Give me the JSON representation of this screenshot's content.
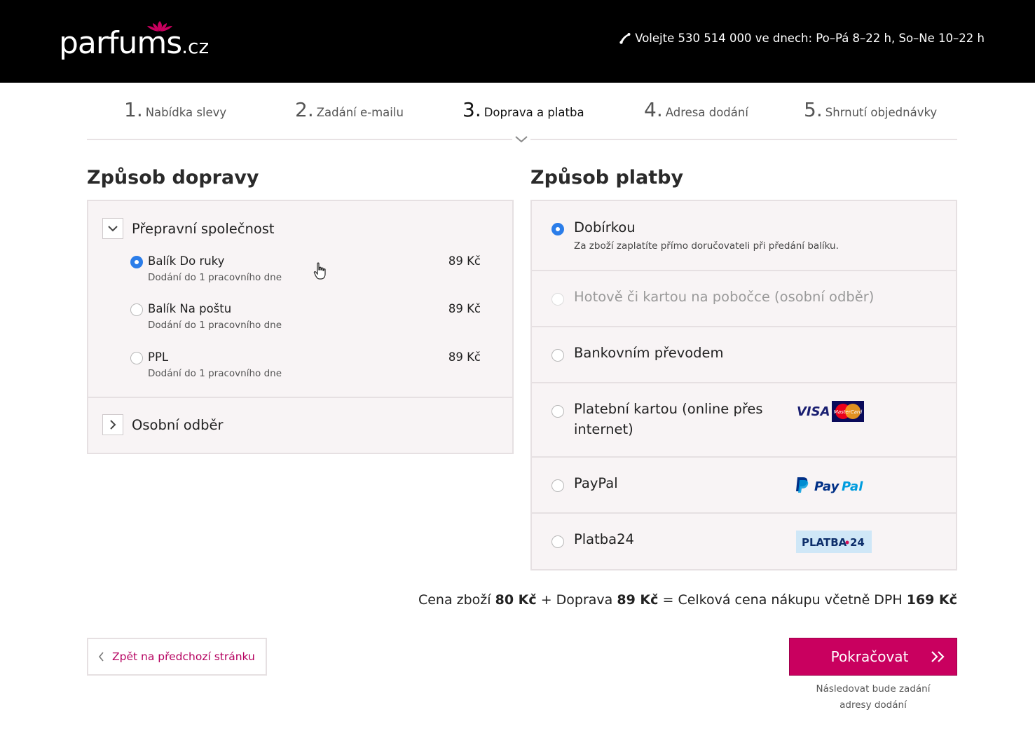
{
  "header": {
    "logo_main": "parfums",
    "logo_tld": ".cz",
    "phone_text": "Volejte 530 514 000 ve dnech: Po–Pá 8–22 h, So–Ne 10–22 h"
  },
  "steps": [
    {
      "num": "1.",
      "label": "Nabídka slevy"
    },
    {
      "num": "2.",
      "label": "Zadání e-mailu"
    },
    {
      "num": "3.",
      "label": "Doprava a platba"
    },
    {
      "num": "4.",
      "label": "Adresa dodání"
    },
    {
      "num": "5.",
      "label": "Shrnutí objednávky"
    }
  ],
  "shipping": {
    "title": "Způsob dopravy",
    "carrier_group": "Přepravní společnost",
    "pickup_group": "Osobní odběr",
    "options": [
      {
        "name": "Balík Do ruky",
        "sub": "Dodání do 1 pracovního dne",
        "price": "89 Kč",
        "selected": true
      },
      {
        "name": "Balík Na poštu",
        "sub": "Dodání do 1 pracovního dne",
        "price": "89 Kč",
        "selected": false
      },
      {
        "name": "PPL",
        "sub": "Dodání do 1 pracovního dne",
        "price": "89 Kč",
        "selected": false
      }
    ]
  },
  "payment": {
    "title": "Způsob platby",
    "options": [
      {
        "name": "Dobírkou",
        "sub": "Za zboží zaplatíte přímo doručovateli při předání balíku.",
        "selected": true
      },
      {
        "name": "Hotově či kartou na pobočce (osobní odběr)",
        "disabled": true
      },
      {
        "name": "Bankovním převodem"
      },
      {
        "name_line1": "Platební kartou (online přes",
        "name_line2": "internet)",
        "logo": "visa-mastercard"
      },
      {
        "name": "PayPal",
        "logo": "paypal"
      },
      {
        "name": "Platba24",
        "logo": "platba24"
      }
    ],
    "logos": {
      "visa": "VISA",
      "mastercard": "MasterCard",
      "paypal_pay": "Pay",
      "paypal_pal": "Pal",
      "platba24_a": "PLATBA",
      "platba24_b": "24"
    }
  },
  "summary": {
    "goods_label": "Cena zboží",
    "goods_value": "80 Kč",
    "plus": "+",
    "shipping_label": "Doprava",
    "shipping_value": "89 Kč",
    "equals": "=",
    "total_label": "Celková cena nákupu včetně DPH",
    "total_value": "169 Kč"
  },
  "actions": {
    "back_label": "Zpět na předchozí stránku",
    "next_label": "Pokračovat",
    "next_note_line1": "Následovat bude zadání",
    "next_note_line2": "adresy dodání"
  },
  "colors": {
    "brand": "#c9005f",
    "radio_selected": "#2b7de9",
    "header_bg": "#000000"
  }
}
